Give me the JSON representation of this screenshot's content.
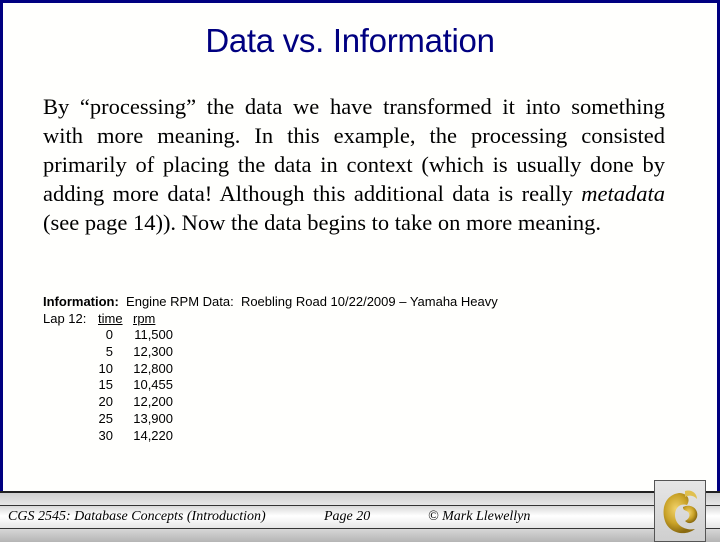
{
  "slide": {
    "title": "Data vs. Information",
    "paragraph": {
      "part1": "By “processing” the data we have transformed it into something with more meaning.  In this example, the processing consisted primarily of placing the data in context (which is usually done by adding more data!  Although this additional data is really ",
      "italic": "metadata",
      "part2": " (see page 14)).  Now the data begins to take on more meaning."
    },
    "info": {
      "label": "Information:",
      "description": "  Engine RPM Data:  Roebling Road 10/22/2009 – Yamaha Heavy",
      "lap_label": "Lap 12:",
      "col_time": "time",
      "col_rpm": "rpm",
      "rows": [
        {
          "time": "0",
          "rpm": "11,500"
        },
        {
          "time": "5",
          "rpm": "12,300"
        },
        {
          "time": "10",
          "rpm": "12,800"
        },
        {
          "time": "15",
          "rpm": "10,455"
        },
        {
          "time": "20",
          "rpm": "12,200"
        },
        {
          "time": "25",
          "rpm": "13,900"
        },
        {
          "time": "30",
          "rpm": "14,220"
        }
      ]
    }
  },
  "footer": {
    "course": "CGS 2545: Database Concepts  (Introduction)",
    "page": "Page 20",
    "author": "© Mark Llewellyn",
    "logo_icon": "ucf-pegasus-logo-icon"
  },
  "colors": {
    "title": "#000080",
    "border": "#000080",
    "logo_gold": "#c9a227"
  }
}
